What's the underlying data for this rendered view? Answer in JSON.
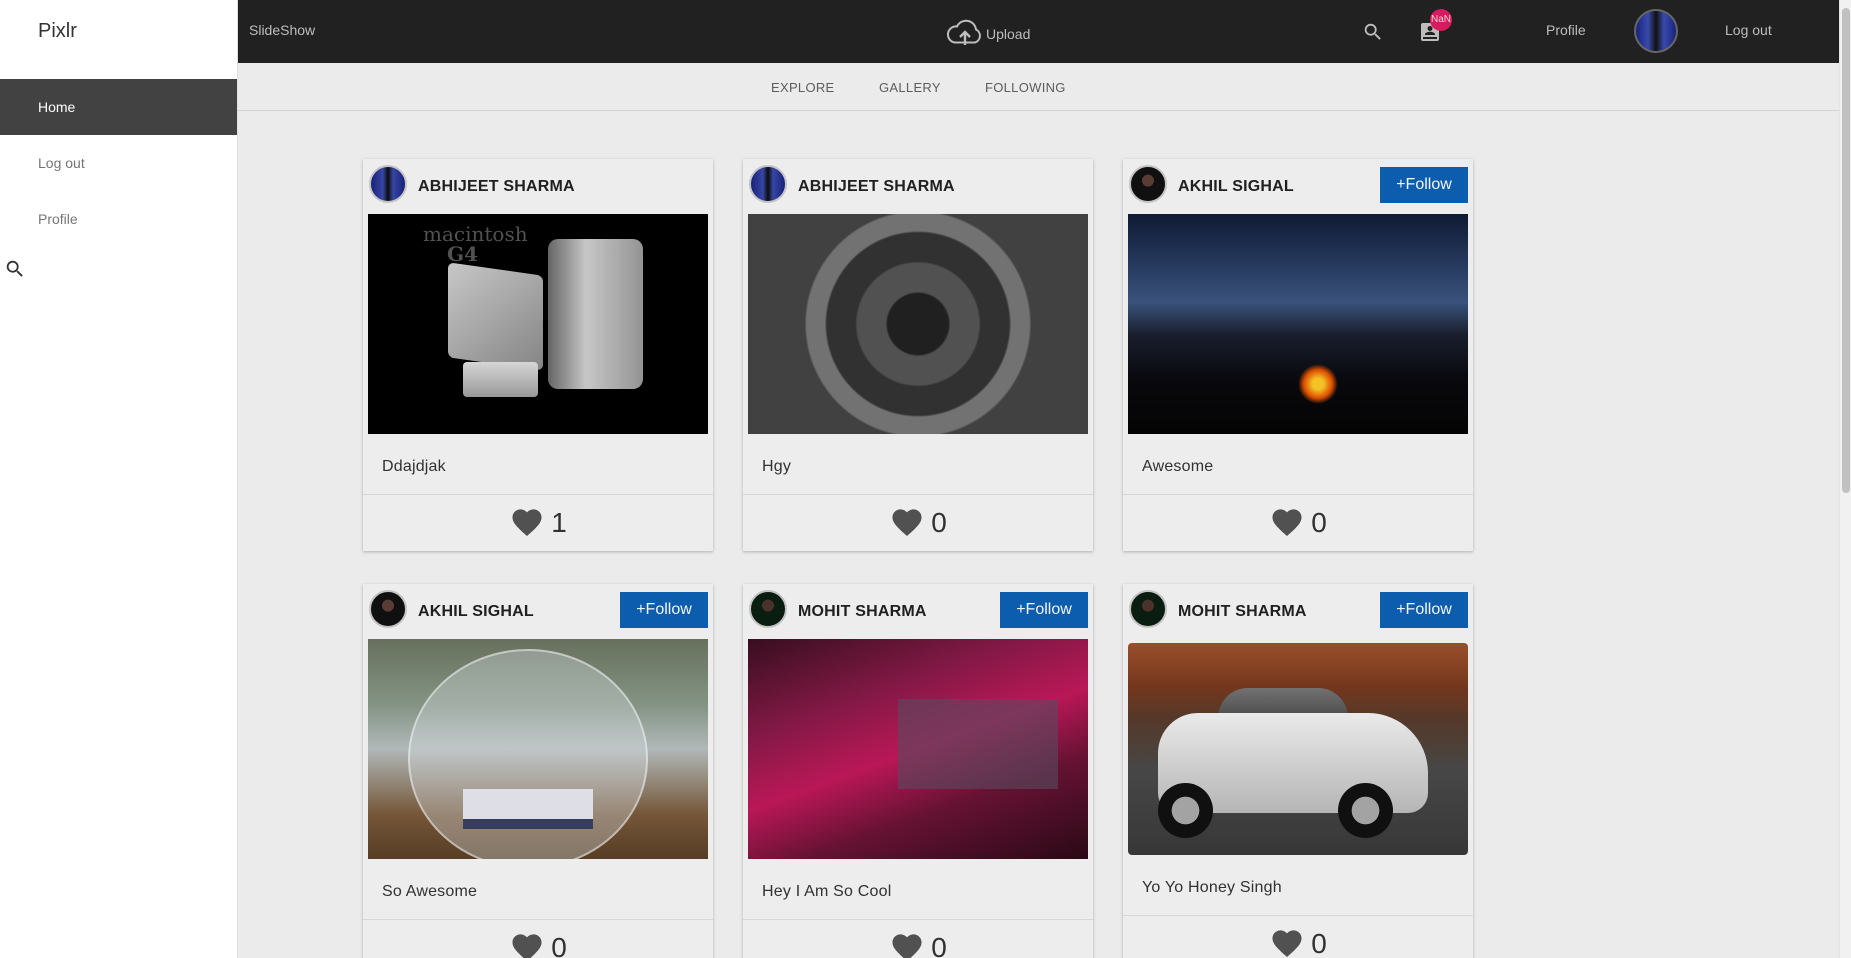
{
  "app": {
    "brand": "Pixlr"
  },
  "sidebar": {
    "items": [
      {
        "label": "Home"
      },
      {
        "label": "Log out"
      },
      {
        "label": "Profile"
      }
    ]
  },
  "topbar": {
    "slideshow_label": "SlideShow",
    "upload_label": "Upload",
    "notification_badge": "NaN",
    "profile_label": "Profile",
    "logout_label": "Log out"
  },
  "tabs": [
    {
      "label": "EXPLORE"
    },
    {
      "label": "GALLERY"
    },
    {
      "label": "FOLLOWING"
    }
  ],
  "posts": [
    {
      "user": "ABHIJEET SHARMA",
      "caption": "Ddajdjak",
      "likes": "1",
      "follow": ""
    },
    {
      "user": "ABHIJEET SHARMA",
      "caption": "Hgy",
      "likes": "0",
      "follow": ""
    },
    {
      "user": "AKHIL SIGHAL",
      "caption": "Awesome",
      "likes": "0",
      "follow": "+Follow"
    },
    {
      "user": "AKHIL SIGHAL",
      "caption": "So Awesome",
      "likes": "0",
      "follow": "+Follow"
    },
    {
      "user": "MOHIT SHARMA",
      "caption": "Hey I Am So Cool",
      "likes": "0",
      "follow": "+Follow"
    },
    {
      "user": "MOHIT SHARMA",
      "caption": "Yo Yo Honey Singh",
      "likes": "0",
      "follow": "+Follow"
    }
  ],
  "image_text": {
    "mac_logo_line1": "macintosh",
    "mac_logo_line2": "G4"
  },
  "colors": {
    "topbar": "#212121",
    "sidebar_active": "#424242",
    "follow_button": "#0d61b6",
    "badge": "#d81b60"
  }
}
